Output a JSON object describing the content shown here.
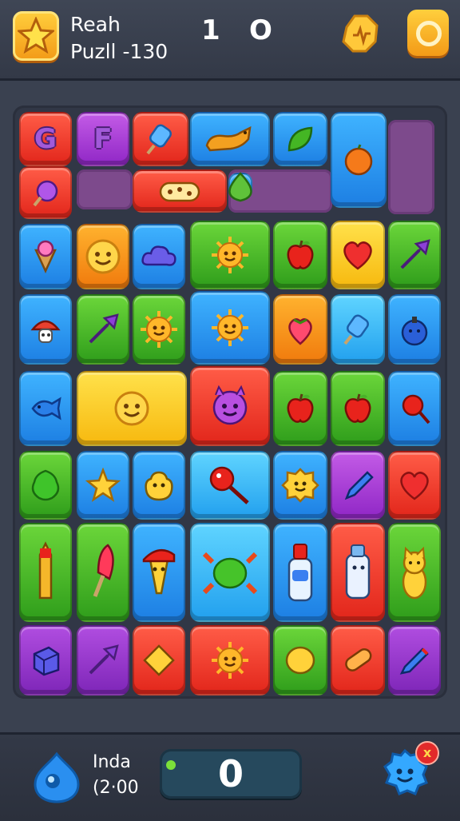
{
  "header": {
    "title_line1": "Reah",
    "title_line2": "Puzll -130",
    "score_left": "1",
    "score_right": "O"
  },
  "footer": {
    "label_line1": "Inda",
    "label_line2": "(2·00",
    "counter_value": "0",
    "notification_glyph": "x"
  },
  "colors": {
    "background": "#3a4150",
    "empty_slot": "#7d4a8c",
    "accent_orange": "#f39a17"
  },
  "board": {
    "tiles": [
      {
        "name": "tile-letter-g",
        "color": "red",
        "icon": "letter",
        "letter": "G"
      },
      {
        "name": "tile-letter-f",
        "color": "purple",
        "icon": "letter",
        "letter": "F"
      },
      {
        "name": "tile-popsicle",
        "color": "red",
        "icon": "popsicle-icon"
      },
      {
        "name": "tile-dog",
        "color": "blue",
        "icon": "dog-icon"
      },
      {
        "name": "tile-leaf",
        "color": "blue",
        "icon": "leaf-icon"
      },
      {
        "name": "tile-orange-fruit",
        "color": "blue",
        "icon": "orange-fruit-icon"
      },
      {
        "name": "tile-candy",
        "color": "red",
        "icon": "candy-icon"
      },
      {
        "name": "tile-cookie",
        "color": "red",
        "icon": "cookie-icon"
      },
      {
        "name": "tile-pear",
        "color": "blue",
        "icon": "pear-icon"
      },
      {
        "name": "tile-icecream-cone",
        "color": "blue",
        "icon": "icecream-cone-icon"
      },
      {
        "name": "tile-smiley",
        "color": "orange",
        "icon": "smiley-icon"
      },
      {
        "name": "tile-cloud",
        "color": "blue",
        "icon": "cloud-icon"
      },
      {
        "name": "tile-sun-face",
        "color": "green",
        "icon": "sun-face-icon"
      },
      {
        "name": "tile-apple",
        "color": "green",
        "icon": "apple-icon"
      },
      {
        "name": "tile-heart",
        "color": "yellow",
        "icon": "heart-icon"
      },
      {
        "name": "tile-green-arrow",
        "color": "green",
        "icon": "arrow-icon"
      },
      {
        "name": "tile-mushroom",
        "color": "blue",
        "icon": "mushroom-icon"
      },
      {
        "name": "tile-pink-arrow",
        "color": "green",
        "icon": "arrow-icon"
      },
      {
        "name": "tile-lion",
        "color": "green",
        "icon": "sun-face-icon"
      },
      {
        "name": "tile-big-sun",
        "color": "blue",
        "icon": "sun-face-icon"
      },
      {
        "name": "tile-strawberry",
        "color": "orange",
        "icon": "strawberry-icon"
      },
      {
        "name": "tile-popsicle-blue",
        "color": "cyan",
        "icon": "popsicle-icon"
      },
      {
        "name": "tile-bomb",
        "color": "blue",
        "icon": "bomb-icon"
      },
      {
        "name": "tile-fish",
        "color": "blue",
        "icon": "fish-icon"
      },
      {
        "name": "tile-duo-smileys",
        "color": "yellow",
        "icon": "smiley-icon"
      },
      {
        "name": "tile-devil",
        "color": "red",
        "icon": "devil-icon"
      },
      {
        "name": "tile-apple-2",
        "color": "green",
        "icon": "apple-icon"
      },
      {
        "name": "tile-apple-3",
        "color": "green",
        "icon": "apple-icon"
      },
      {
        "name": "tile-lollipop",
        "color": "blue",
        "icon": "lollipop-icon"
      },
      {
        "name": "tile-lettuce",
        "color": "green",
        "icon": "lettuce-icon"
      },
      {
        "name": "tile-star",
        "color": "blue",
        "icon": "star-icon"
      },
      {
        "name": "tile-blob",
        "color": "blue",
        "icon": "blob-icon"
      },
      {
        "name": "tile-paddle",
        "color": "cyan",
        "icon": "paddle-icon"
      },
      {
        "name": "tile-flower",
        "color": "blue",
        "icon": "flower-icon"
      },
      {
        "name": "tile-pencil",
        "color": "purple",
        "icon": "pencil-icon"
      },
      {
        "name": "tile-heart-2",
        "color": "red",
        "icon": "heart-icon"
      },
      {
        "name": "tile-crayon",
        "color": "green",
        "icon": "crayon-icon"
      },
      {
        "name": "tile-icepop",
        "color": "green",
        "icon": "icepop-icon"
      },
      {
        "name": "tile-hat-cone",
        "color": "blue",
        "icon": "hat-cone-icon"
      },
      {
        "name": "tile-turtle",
        "color": "cyan",
        "icon": "turtle-icon"
      },
      {
        "name": "tile-bottle",
        "color": "blue",
        "icon": "bottle-icon"
      },
      {
        "name": "tile-robot",
        "color": "red",
        "icon": "robot-icon"
      },
      {
        "name": "tile-cat",
        "color": "green",
        "icon": "cat-icon"
      },
      {
        "name": "tile-cube",
        "color": "violet",
        "icon": "cube-icon"
      },
      {
        "name": "tile-gem-arrow",
        "color": "violet",
        "icon": "arrow-icon"
      },
      {
        "name": "tile-diamond",
        "color": "red",
        "icon": "diamond-icon"
      },
      {
        "name": "tile-sun-red",
        "color": "red",
        "icon": "sun-face-icon"
      },
      {
        "name": "tile-lemon",
        "color": "green",
        "icon": "lemon-icon"
      },
      {
        "name": "tile-bread",
        "color": "red",
        "icon": "bread-icon"
      },
      {
        "name": "tile-pen",
        "color": "violet",
        "icon": "pen-icon"
      }
    ]
  }
}
